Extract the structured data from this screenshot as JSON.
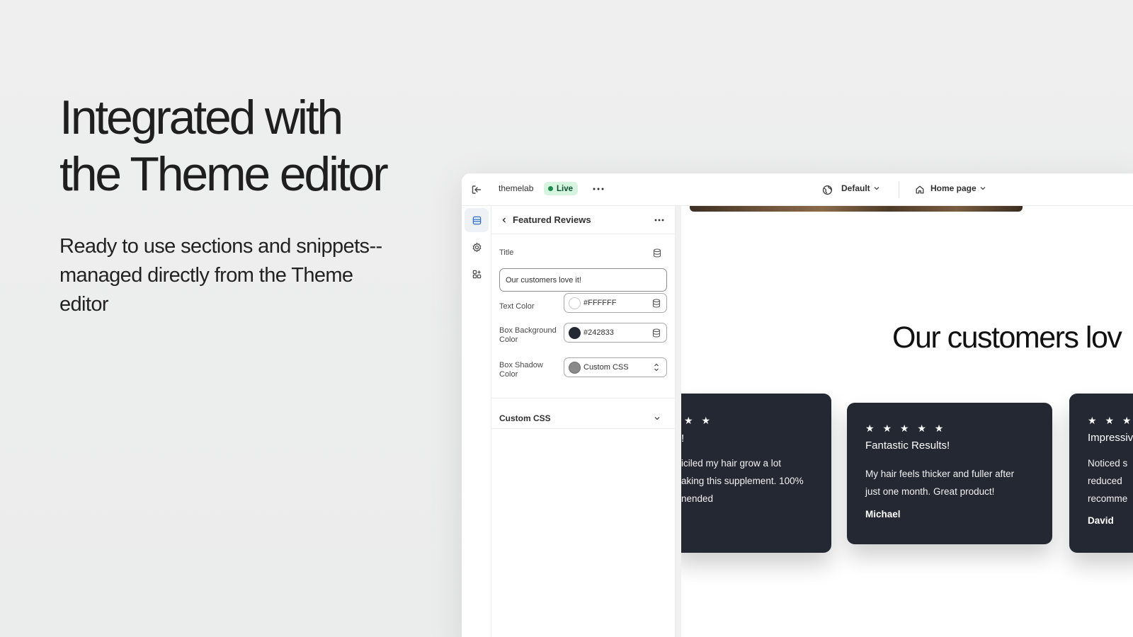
{
  "hero": {
    "title_line1": "Integrated with",
    "title_line2": "the Theme editor",
    "subtitle": "Ready to use sections and snippets--managed directly from the Theme editor"
  },
  "topbar": {
    "store_name": "themelab",
    "status_badge": "Live",
    "theme_selector": "Default",
    "page_selector": "Home page",
    "icons": [
      "exit-icon",
      "more-horizontal-icon",
      "globe-icon",
      "chevron-down-icon",
      "home-icon"
    ]
  },
  "sidebar_rail": {
    "items": [
      "sections-icon",
      "settings-gear-icon",
      "apps-icon"
    ],
    "active": "sections-icon"
  },
  "panel": {
    "title": "Featured Reviews",
    "fields": {
      "title_label": "Title",
      "title_value": "Our customers love it!",
      "text_color_label": "Text Color",
      "text_color_value": "#FFFFFF",
      "box_bg_label_line1": "Box Background",
      "box_bg_label_line2": "Color",
      "box_bg_value": "#242833",
      "box_shadow_label_line1": "Box Shadow",
      "box_shadow_label_line2": "Color",
      "box_shadow_value": "Custom CSS"
    },
    "collapsible_title": "Custom CSS",
    "colors": {
      "text_swatch": "#FFFFFF",
      "bg_swatch": "#242833",
      "shadow_swatch": "#8a8a8a"
    }
  },
  "preview": {
    "heading": "Our customers lov",
    "reviews": [
      {
        "stars": "★ ★",
        "title": "!",
        "body_lines": [
          "iciled my hair grow a lot",
          "aking this supplement. 100%",
          "nended"
        ],
        "author": ""
      },
      {
        "stars": "★ ★ ★ ★ ★",
        "title": "Fantastic Results!",
        "body_lines": [
          "My hair feels thicker and fuller after",
          "just one month. Great product!"
        ],
        "author": "Michael"
      },
      {
        "stars": "★ ★ ★",
        "title": "Impressiv",
        "body_lines": [
          "Noticed s",
          "reduced",
          "recomme"
        ],
        "author": "David"
      }
    ]
  }
}
